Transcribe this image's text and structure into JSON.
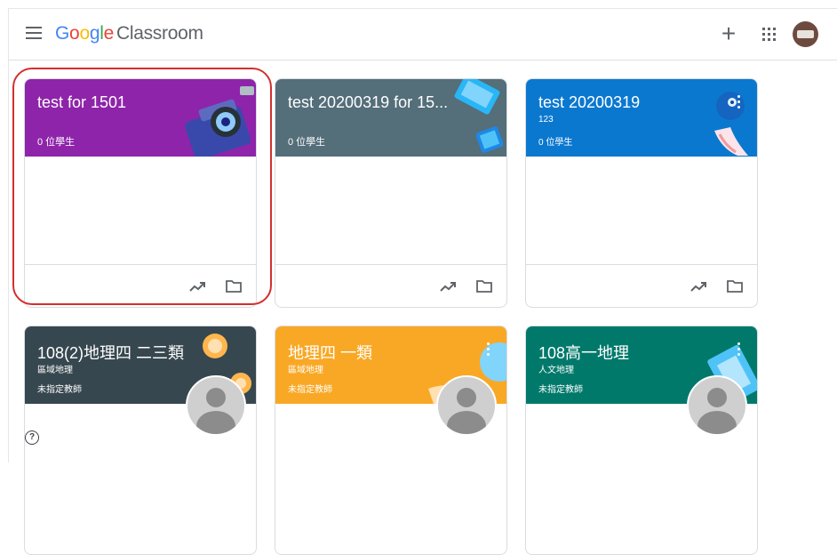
{
  "header": {
    "logo_letters": [
      "G",
      "o",
      "o",
      "g",
      "l",
      "e"
    ],
    "product": "Classroom",
    "icons": [
      "menu-icon",
      "plus-icon",
      "apps-grid-icon",
      "account-avatar"
    ]
  },
  "classes": [
    {
      "title": "test for 1501",
      "subtitle": "0 位學生",
      "color": "#8e24aa",
      "art": "camera"
    },
    {
      "title": "test 20200319 for 15...",
      "subtitle": "0 位學生",
      "color": "#546e7a",
      "art": "devices"
    },
    {
      "title": "test 20200319",
      "line1": "123",
      "subtitle": "0 位學生",
      "color": "#0b78d0",
      "art": "robot"
    },
    {
      "title": "108(2)地理四 二三類",
      "line1": "區域地理",
      "line2": "未指定教師",
      "color": "#37474f",
      "art": "coins"
    },
    {
      "title": "地理四 一類",
      "line1": "區域地理",
      "line2": "未指定教師",
      "color": "#f9a825",
      "art": "globe"
    },
    {
      "title": "108高一地理",
      "line1": "人文地理",
      "line2": "未指定教師",
      "color": "#00796b",
      "art": "map"
    }
  ],
  "footer_icons": [
    "trending-icon",
    "folder-icon"
  ],
  "help_label": "?",
  "colors": {
    "highlight": "#d32f2f",
    "divider": "#dadce0",
    "icon": "#5f6368"
  }
}
